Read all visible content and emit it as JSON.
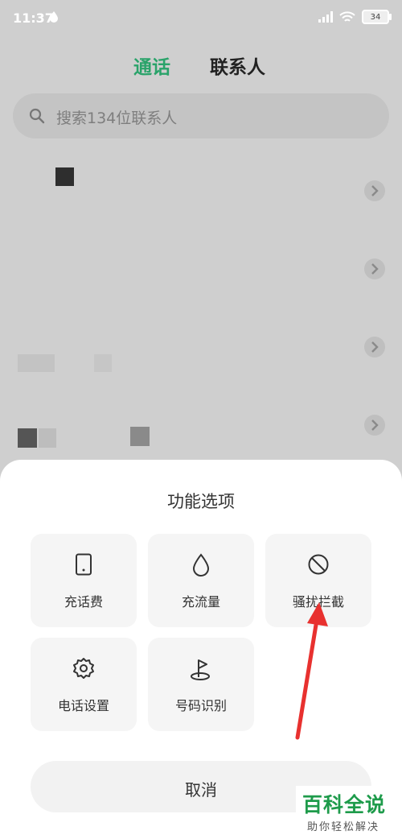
{
  "status": {
    "time": "11:37",
    "battery": "34"
  },
  "tabs": [
    {
      "label": "通话"
    },
    {
      "label": "联系人"
    }
  ],
  "search": {
    "placeholder": "搜索134位联系人"
  },
  "sheet": {
    "title": "功能选项",
    "items": [
      {
        "label": "充话费",
        "icon": "phone-icon"
      },
      {
        "label": "充流量",
        "icon": "water-drop-icon"
      },
      {
        "label": "骚扰拦截",
        "icon": "block-icon"
      },
      {
        "label": "电话设置",
        "icon": "gear-icon"
      },
      {
        "label": "号码识别",
        "icon": "flag-icon"
      }
    ],
    "cancel_label": "取消"
  },
  "watermark": {
    "title": "百科全说",
    "subtitle": "助你轻松解决"
  },
  "colors": {
    "accent": "#2aa36a",
    "arrow": "#e8312f",
    "watermark": "#1e9b4b"
  }
}
